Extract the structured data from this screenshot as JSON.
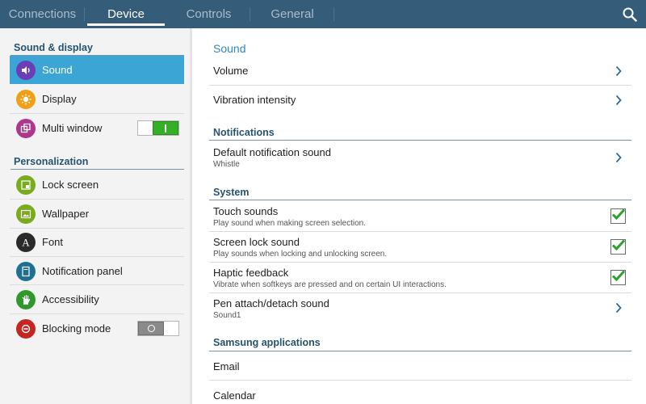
{
  "tabs": [
    {
      "label": "Connections"
    },
    {
      "label": "Device"
    },
    {
      "label": "Controls"
    },
    {
      "label": "General"
    }
  ],
  "search": {
    "icon": "search-icon"
  },
  "left": {
    "section1": "Sound & display",
    "section2": "Personalization",
    "items": [
      {
        "label": "Sound",
        "icon": "speaker-icon",
        "color": "#6a3fb6"
      },
      {
        "label": "Display",
        "icon": "brightness-icon",
        "color": "#f0a018"
      },
      {
        "label": "Multi window",
        "icon": "multi-window-icon",
        "color": "#b0368d",
        "toggle": "on"
      },
      {
        "label": "Lock screen",
        "icon": "lock-screen-icon",
        "color": "#79ab1e"
      },
      {
        "label": "Wallpaper",
        "icon": "wallpaper-icon",
        "color": "#79ab1e"
      },
      {
        "label": "Font",
        "icon": "font-icon",
        "color": "#2a2a2a"
      },
      {
        "label": "Notification panel",
        "icon": "notification-panel-icon",
        "color": "#1f6f93"
      },
      {
        "label": "Accessibility",
        "icon": "hand-icon",
        "color": "#2f9a2c"
      },
      {
        "label": "Blocking mode",
        "icon": "blocking-icon",
        "color": "#c52622",
        "toggle": "off"
      }
    ]
  },
  "right": {
    "title": "Sound",
    "sections": {
      "notifications": "Notifications",
      "system": "System",
      "samsung": "Samsung applications"
    },
    "items": [
      {
        "label": "Volume"
      },
      {
        "label": "Vibration intensity"
      },
      {
        "label": "Default notification sound",
        "sub": "Whistle"
      },
      {
        "label": "Touch sounds",
        "sub": "Play sound when making screen selection.",
        "checked": true
      },
      {
        "label": "Screen lock sound",
        "sub": "Play sounds when locking and unlocking screen.",
        "checked": true
      },
      {
        "label": "Haptic feedback",
        "sub": "Vibrate when softkeys are pressed and on certain UI interactions.",
        "checked": true
      },
      {
        "label": "Pen attach/detach sound",
        "sub": "Sound1"
      },
      {
        "label": "Email"
      },
      {
        "label": "Calendar"
      }
    ]
  },
  "colors": {
    "topbar": "#355c78",
    "selected": "#3ba6d6",
    "accent": "#2b88c9",
    "check": "#2aa12a"
  }
}
